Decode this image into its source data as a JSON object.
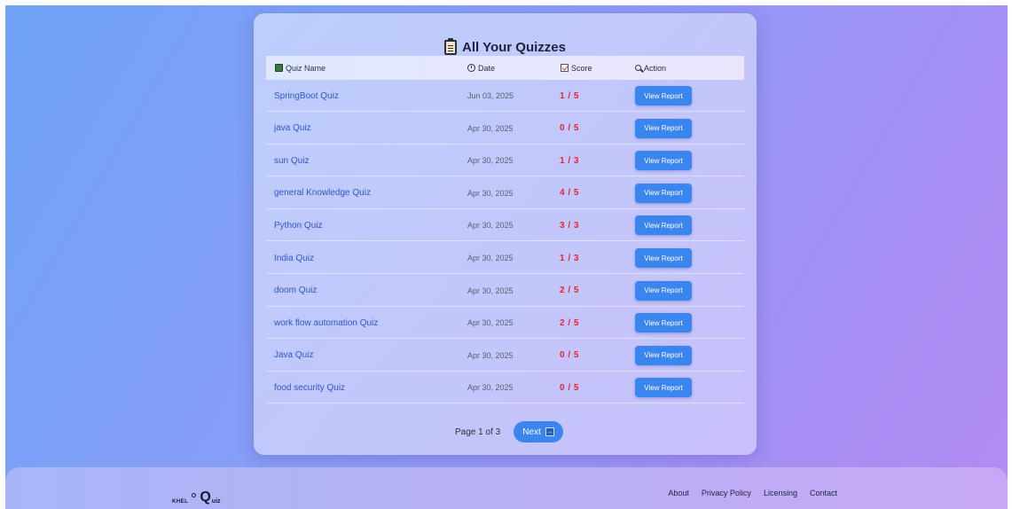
{
  "page": {
    "title": "All Your Quizzes"
  },
  "table": {
    "headers": {
      "quiz_name": "Quiz Name",
      "date": "Date",
      "score": "Score",
      "action": "Action"
    },
    "rows": [
      {
        "name": "SpringBoot Quiz",
        "date": "Jun 03, 2025",
        "score": "1 / 5",
        "action": "View Report"
      },
      {
        "name": "java Quiz",
        "date": "Apr 30, 2025",
        "score": "0 / 5",
        "action": "View Report"
      },
      {
        "name": "sun Quiz",
        "date": "Apr 30, 2025",
        "score": "1 / 3",
        "action": "View Report"
      },
      {
        "name": "general Knowledge Quiz",
        "date": "Apr 30, 2025",
        "score": "4 / 5",
        "action": "View Report"
      },
      {
        "name": "Python Quiz",
        "date": "Apr 30, 2025",
        "score": "3 / 3",
        "action": "View Report"
      },
      {
        "name": "India Quiz",
        "date": "Apr 30, 2025",
        "score": "1 / 3",
        "action": "View Report"
      },
      {
        "name": "doom Quiz",
        "date": "Apr 30, 2025",
        "score": "2 / 5",
        "action": "View Report"
      },
      {
        "name": "work flow automation Quiz",
        "date": "Apr 30, 2025",
        "score": "2 / 5",
        "action": "View Report"
      },
      {
        "name": "Java Quiz",
        "date": "Apr 30, 2025",
        "score": "0 / 5",
        "action": "View Report"
      },
      {
        "name": "food security Quiz",
        "date": "Apr 30, 2025",
        "score": "0 / 5",
        "action": "View Report"
      }
    ]
  },
  "pagination": {
    "info": "Page 1 of 3",
    "next_label": "Next",
    "next_icon": "→"
  },
  "footer": {
    "logo_small": "KHEL",
    "logo_q": "Q",
    "logo_uiz": "uiz",
    "links": [
      "About",
      "Privacy Policy",
      "Licensing",
      "Contact"
    ]
  },
  "colors": {
    "accent": "#3b86ee",
    "score": "#e2262a",
    "link": "#2f55c8"
  }
}
